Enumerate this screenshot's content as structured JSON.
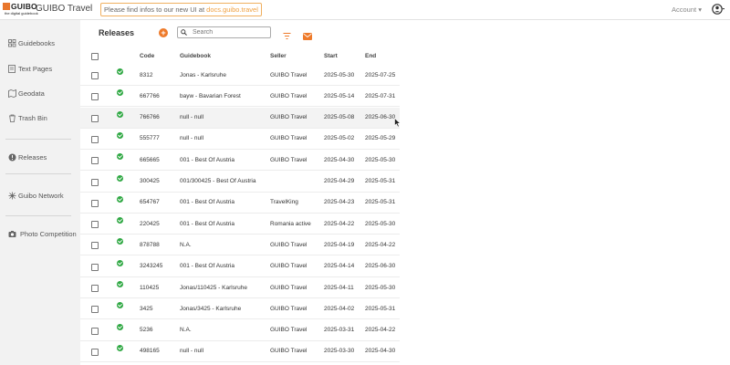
{
  "header": {
    "logo_text": "GUIBO",
    "logo_tagline": "the digital guidebook",
    "app_title": "GUIBO Travel",
    "notice_prefix": "Please find infos to our new UI at ",
    "notice_link": "docs.guibo.travel",
    "account_label": "Account",
    "user_icon": "account-circle-icon"
  },
  "sidebar": {
    "items": [
      {
        "label": "Guidebooks",
        "icon": "grid-icon"
      },
      {
        "label": "Text Pages",
        "icon": "text-page-icon"
      },
      {
        "label": "Geodata",
        "icon": "map-icon"
      },
      {
        "label": "Trash Bin",
        "icon": "trash-icon"
      },
      {
        "label": "Releases",
        "icon": "info-icon"
      },
      {
        "label": "Guibo Network",
        "icon": "network-icon"
      },
      {
        "label": "Photo Competition",
        "icon": "camera-icon"
      }
    ]
  },
  "main": {
    "title": "Releases",
    "search_placeholder": "Search",
    "columns": [
      "Code",
      "Guidebook",
      "Seller",
      "Start",
      "End"
    ],
    "accent_color": "#ee7a2a",
    "status_color": "#2fa843",
    "rows": [
      {
        "code": "8312",
        "guidebook": "Jonas - Karlsruhe",
        "seller": "GUIBO Travel",
        "start": "2025-05-30",
        "end": "2025-07-25"
      },
      {
        "code": "667766",
        "guidebook": "bayw - Bavarian Forest",
        "seller": "GUIBO Travel",
        "start": "2025-05-14",
        "end": "2025-07-31"
      },
      {
        "code": "766766",
        "guidebook": "null - null",
        "seller": "GUIBO Travel",
        "start": "2025-05-08",
        "end": "2025-06-30"
      },
      {
        "code": "555777",
        "guidebook": "null - null",
        "seller": "GUIBO Travel",
        "start": "2025-05-02",
        "end": "2025-05-29"
      },
      {
        "code": "665665",
        "guidebook": "001 - Best Of Austria",
        "seller": "GUIBO Travel",
        "start": "2025-04-30",
        "end": "2025-05-30"
      },
      {
        "code": "300425",
        "guidebook": "001/300425 - Best Of Austria",
        "seller": "",
        "start": "2025-04-29",
        "end": "2025-05-31"
      },
      {
        "code": "654767",
        "guidebook": "001 - Best Of Austria",
        "seller": "TravelKing",
        "start": "2025-04-23",
        "end": "2025-05-31"
      },
      {
        "code": "220425",
        "guidebook": "001 - Best Of Austria",
        "seller": "Romania active",
        "start": "2025-04-22",
        "end": "2025-05-30"
      },
      {
        "code": "878788",
        "guidebook": "N.A.",
        "seller": "GUIBO Travel",
        "start": "2025-04-19",
        "end": "2025-04-22"
      },
      {
        "code": "3243245",
        "guidebook": "001 - Best Of Austria",
        "seller": "GUIBO Travel",
        "start": "2025-04-14",
        "end": "2025-06-30"
      },
      {
        "code": "110425",
        "guidebook": "Jonas/110425 - Karlsruhe",
        "seller": "GUIBO Travel",
        "start": "2025-04-11",
        "end": "2025-05-30"
      },
      {
        "code": "3425",
        "guidebook": "Jonas/3425 - Karlsruhe",
        "seller": "GUIBO Travel",
        "start": "2025-04-02",
        "end": "2025-05-31"
      },
      {
        "code": "5236",
        "guidebook": "N.A.",
        "seller": "GUIBO Travel",
        "start": "2025-03-31",
        "end": "2025-04-22"
      },
      {
        "code": "498165",
        "guidebook": "null - null",
        "seller": "GUIBO Travel",
        "start": "2025-03-30",
        "end": "2025-04-30"
      }
    ]
  }
}
